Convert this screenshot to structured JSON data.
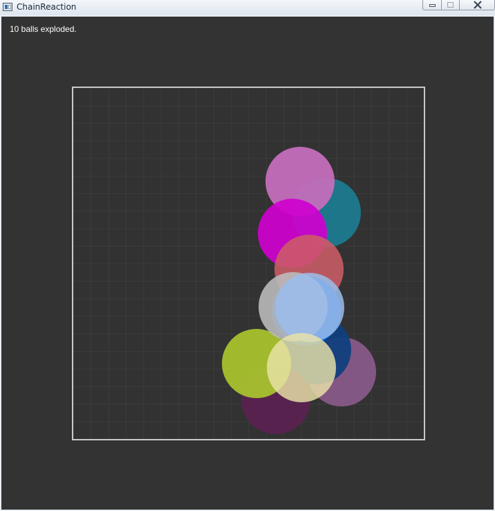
{
  "window": {
    "title": "ChainReaction"
  },
  "status": {
    "text": "10 balls exploded."
  },
  "balls": [
    {
      "id": "teal",
      "color": "#1e7a8f",
      "opacity": 0.95
    },
    {
      "id": "orchid",
      "color": "#c46ebb",
      "opacity": 0.95
    },
    {
      "id": "mauve",
      "color": "#8a5a8a",
      "opacity": 0.92
    },
    {
      "id": "navy",
      "color": "#0e3f7e",
      "opacity": 0.92
    },
    {
      "id": "plum",
      "color": "#5b2250",
      "opacity": 0.95
    },
    {
      "id": "lime",
      "color": "#a8c22d",
      "opacity": 0.95
    },
    {
      "id": "magenta",
      "color": "#cf00cf",
      "opacity": 0.92
    },
    {
      "id": "salmon",
      "color": "#cc5c66",
      "opacity": 0.88
    },
    {
      "id": "blue",
      "color": "#0a5fd6",
      "opacity": 0.95
    },
    {
      "id": "silver",
      "color": "#bdbdbd",
      "opacity": 0.88
    },
    {
      "id": "light-blue",
      "color": "#9cbdeb",
      "opacity": 0.85
    },
    {
      "id": "cream",
      "color": "#e9e3a8",
      "opacity": 0.82
    }
  ],
  "colors": {
    "client_background": "#333333",
    "board_border": "#c9c9c9",
    "status_text": "#ffffff"
  }
}
